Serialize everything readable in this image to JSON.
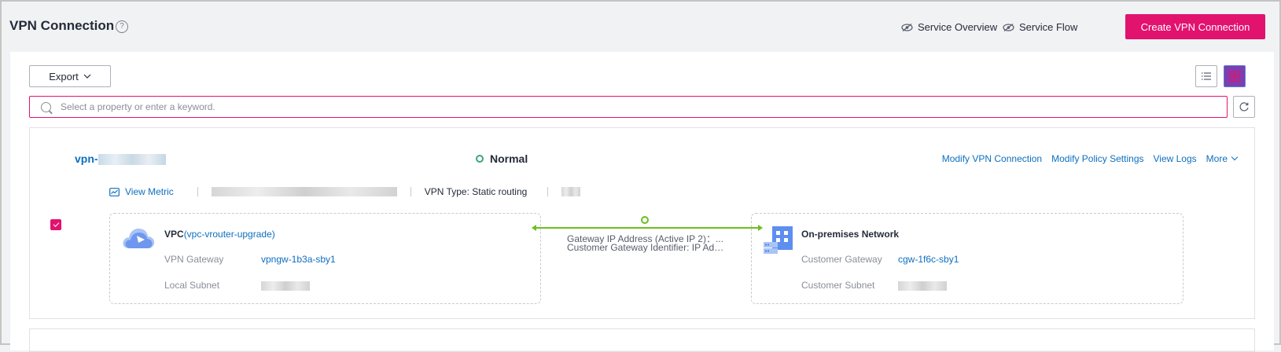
{
  "header": {
    "title": "VPN Connection",
    "help_icon": "question-circle-icon",
    "service_overview_label": "Service Overview",
    "service_flow_label": "Service Flow",
    "create_button_label": "Create VPN Connection",
    "accent_color": "#e2126f"
  },
  "toolbar": {
    "export_label": "Export",
    "search_placeholder": "Select a property or enter a keyword.",
    "view_modes": [
      "list-view-icon",
      "card-view-icon"
    ],
    "active_view": "card"
  },
  "connection": {
    "name_prefix": "vpn-",
    "status": "Normal",
    "status_color": "#3ca57a",
    "actions": [
      "Modify VPN Connection",
      "Modify Policy Settings",
      "View Logs",
      "More"
    ],
    "view_metric_label": "View Metric",
    "vpn_type": "VPN Type: Static routing",
    "selected": true,
    "vpc": {
      "title": "VPC",
      "vpc_id": "(vpc-vrouter-upgrade)",
      "vpn_gateway_label": "VPN Gateway",
      "vpn_gateway_value": "vpngw-1b3a-sby1",
      "local_subnet_label": "Local Subnet"
    },
    "link": {
      "gateway_ip": "Gateway IP Address (Active IP 2)：...",
      "customer_gateway_identifier": "Customer Gateway Identifier: IP Addr..."
    },
    "on_premises": {
      "title": "On-premises Network",
      "customer_gateway_label": "Customer Gateway",
      "customer_gateway_value": "cgw-1f6c-sby1",
      "customer_subnet_label": "Customer Subnet"
    }
  }
}
